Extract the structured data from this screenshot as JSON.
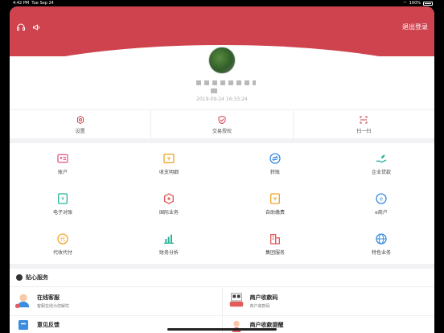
{
  "status_bar": {
    "time": "4:42 PM",
    "date": "Tue Sep 24",
    "battery": "100%"
  },
  "header": {
    "logout_label": "退出登录",
    "headset_icon": "headset-icon",
    "megaphone_icon": "megaphone-icon",
    "color": "#cf434f"
  },
  "profile": {
    "timestamp": "2019-09-24 16:33:24"
  },
  "quick_actions": [
    {
      "label": "设置",
      "icon": "gear-icon"
    },
    {
      "label": "交易授权",
      "icon": "shield-check-icon"
    },
    {
      "label": "扫一扫",
      "icon": "scan-icon"
    }
  ],
  "services_grid": [
    {
      "label": "账户",
      "icon": "account-card-icon",
      "color": "#e35d8f"
    },
    {
      "label": "收支明细",
      "icon": "yen-box-icon",
      "color": "#f0a52a"
    },
    {
      "label": "转账",
      "icon": "transfer-icon",
      "color": "#3a8de0"
    },
    {
      "label": "企业贷款",
      "icon": "loan-hand-icon",
      "color": "#2bb39a"
    },
    {
      "label": "电子对账",
      "icon": "e-statement-icon",
      "color": "#2bb39a"
    },
    {
      "label": "国际业务",
      "icon": "globe-business-icon",
      "color": "#e35d5d"
    },
    {
      "label": "自助缴费",
      "icon": "self-pay-icon",
      "color": "#f0a52a"
    },
    {
      "label": "e商户",
      "icon": "e-merchant-icon",
      "color": "#3a8de0"
    },
    {
      "label": "代收代付",
      "icon": "collect-pay-icon",
      "color": "#f0a52a"
    },
    {
      "label": "财务分析",
      "icon": "finance-chart-icon",
      "color": "#2bb39a"
    },
    {
      "label": "集团服务",
      "icon": "group-building-icon",
      "color": "#e35d5d"
    },
    {
      "label": "特色业务",
      "icon": "feature-globe-icon",
      "color": "#3a8de0"
    }
  ],
  "care_section": {
    "title": "贴心服务",
    "items": [
      {
        "title": "在线客服",
        "subtitle": "客服在线为您解忧",
        "icon": "online-service-icon"
      },
      {
        "title": "商户收款码",
        "subtitle": "商户收款码",
        "icon": "merchant-qr-icon"
      },
      {
        "title": "意见反馈",
        "subtitle": "",
        "icon": "feedback-icon"
      },
      {
        "title": "商户收款提醒",
        "subtitle": "",
        "icon": "merchant-alert-icon"
      }
    ]
  }
}
